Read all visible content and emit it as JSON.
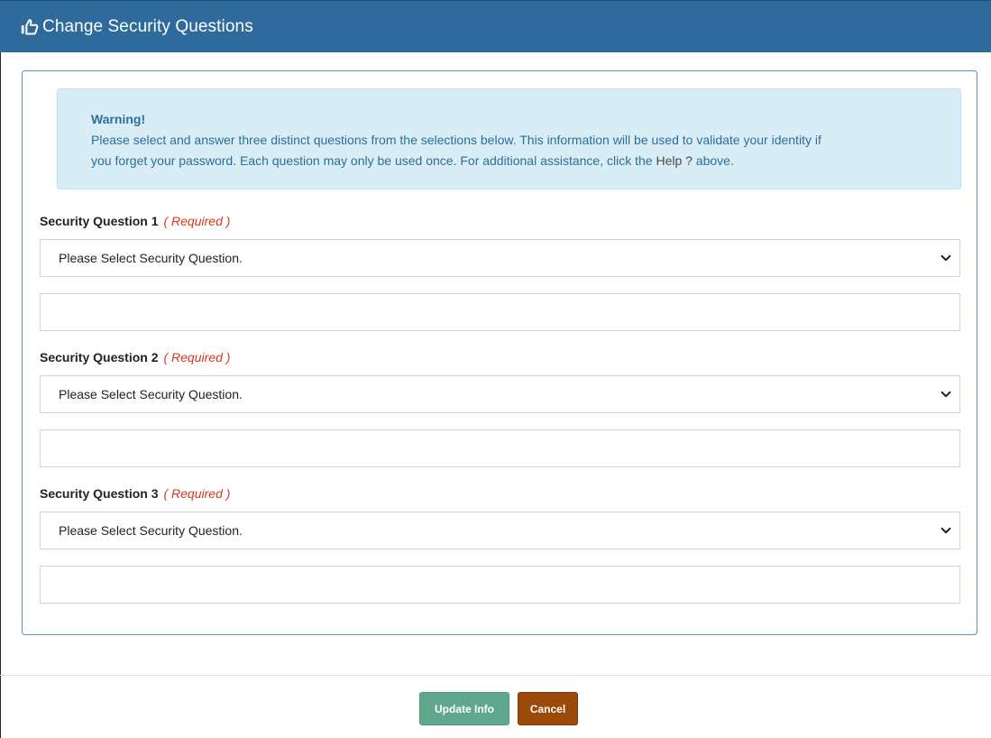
{
  "header": {
    "title": "Change Security Questions",
    "icon": "thumbs-up-icon",
    "bg_color": "#2e6a9c"
  },
  "alert": {
    "heading": "Warning!",
    "line1": "Please select and answer three distinct questions from the selections below. This information will be used to validate your identity if",
    "line2_prefix": "you forget your password. Each question may only be used once. For additional assistance, click the ",
    "line2_help": "Help ?",
    "line2_suffix": " above."
  },
  "questions": [
    {
      "label": "Security Question 1",
      "required": "( Required )",
      "select_value": "Please Select Security Question.",
      "answer": ""
    },
    {
      "label": "Security Question 2",
      "required": "( Required )",
      "select_value": "Please Select Security Question.",
      "answer": ""
    },
    {
      "label": "Security Question 3",
      "required": "( Required )",
      "select_value": "Please Select Security Question.",
      "answer": ""
    }
  ],
  "buttons": {
    "update": "Update Info",
    "cancel": "Cancel",
    "update_color": "#5fa88e",
    "cancel_color": "#9c4a0a"
  }
}
